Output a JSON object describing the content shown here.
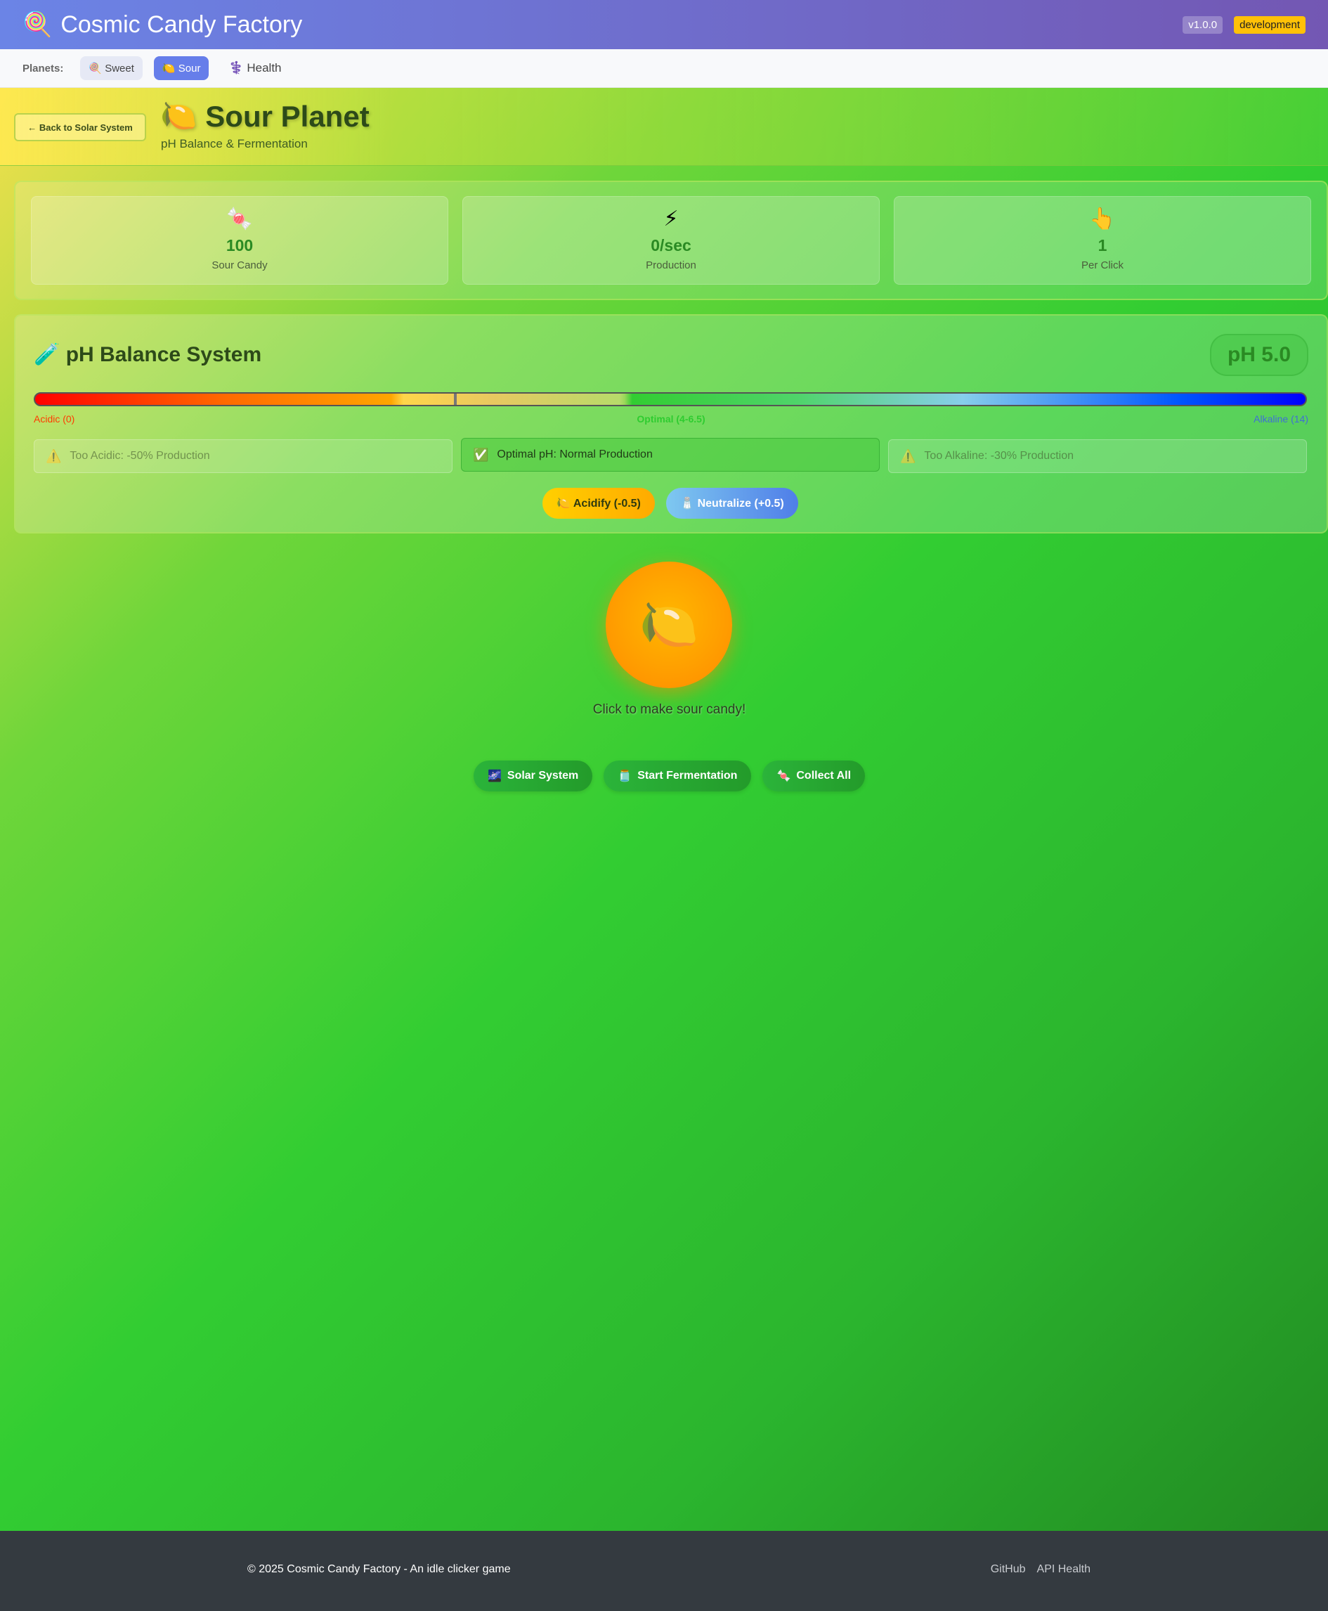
{
  "header": {
    "app_icon": "lollipop-icon",
    "app_title": "Cosmic Candy Factory",
    "version": "v1.0.0",
    "environment": "development",
    "colors": {
      "gradient_start": "#6b84e6",
      "gradient_end": "#7357b3"
    }
  },
  "planet_nav": {
    "label": "Planets:",
    "items": [
      {
        "icon": "🍭",
        "label": "Sweet",
        "active": false
      },
      {
        "icon": "🍋",
        "label": "Sour",
        "active": true
      },
      {
        "icon": "⚕️",
        "label": "Health",
        "active": false
      }
    ]
  },
  "planet": {
    "back_label": "← Back to Solar System",
    "icon": "🍋",
    "title": "Sour Planet",
    "subtitle": "pH Balance & Fermentation"
  },
  "stats": [
    {
      "icon": "🍬",
      "value": "100",
      "label": "Sour Candy"
    },
    {
      "icon": "⚡",
      "value": "0/sec",
      "label": "Production"
    },
    {
      "icon": "👆",
      "value": "1",
      "label": "Per Click"
    }
  ],
  "ph_system": {
    "icon": "🧪",
    "title": "pH Balance System",
    "current_label": "pH 5.0",
    "current_ph": 5.0,
    "optimal_range": [
      4,
      6.5
    ],
    "scale_min": 0,
    "scale_max": 14,
    "scale_labels": {
      "acidic": "Acidic (0)",
      "optimal": "Optimal (4-6.5)",
      "alkaline": "Alkaline (14)"
    },
    "effects": [
      {
        "icon": "⚠️",
        "text": "Too Acidic: -50% Production",
        "active": false
      },
      {
        "icon": "✅",
        "text": "Optimal pH: Normal Production",
        "active": true
      },
      {
        "icon": "⚠️",
        "text": "Too Alkaline: -30% Production",
        "active": false
      }
    ],
    "acidify_label": "🍋 Acidify (-0.5)",
    "neutralize_label": "🧂 Neutralize (+0.5)"
  },
  "clicker": {
    "icon": "🍋",
    "hint": "Click to make sour candy!"
  },
  "actions": [
    {
      "icon": "🌌",
      "label": "Solar System"
    },
    {
      "icon": "🫙",
      "label": "Start Fermentation"
    },
    {
      "icon": "🍬",
      "label": "Collect All"
    }
  ],
  "footer": {
    "copyright": "© 2025 Cosmic Candy Factory - An idle clicker game",
    "links": [
      "GitHub",
      "API Health"
    ]
  }
}
